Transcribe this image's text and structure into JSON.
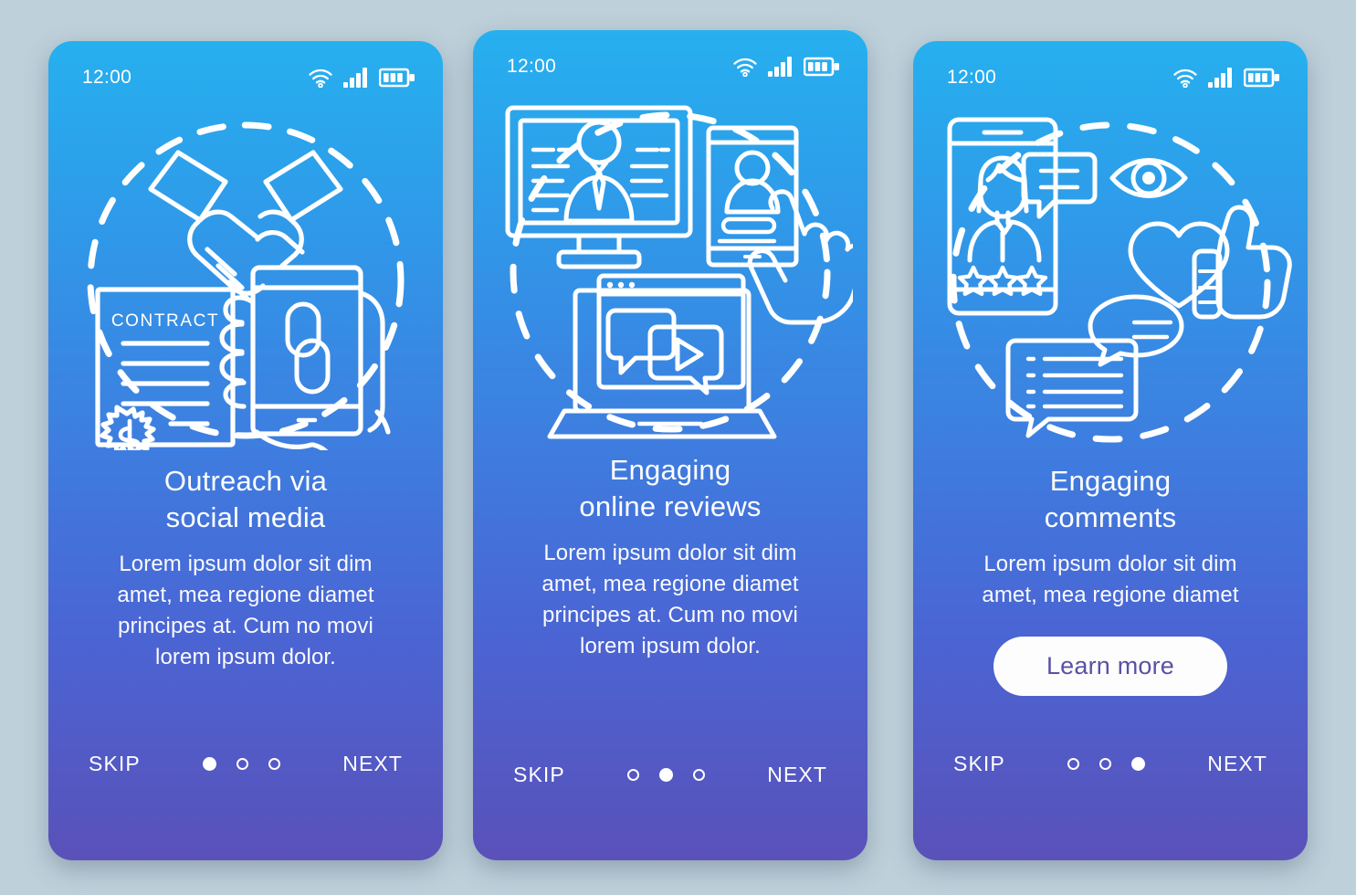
{
  "background_color": "#bed0da",
  "gradient": {
    "top": "#26b0ef",
    "bottom": "#5a51b9"
  },
  "accent": {
    "button_bg": "#fdfdfd",
    "button_text": "#5851a6",
    "line_color": "#ffffff"
  },
  "statusbar": {
    "time": "12:00",
    "icons": [
      "wifi-icon",
      "cellular-signal-icon",
      "battery-icon"
    ]
  },
  "nav_labels": {
    "skip": "SKIP",
    "next": "NEXT"
  },
  "screens": [
    {
      "id": "outreach-via-social-media",
      "title": "Outreach via\nsocial media",
      "body": "Lorem ipsum dolor sit dim\namet, mea regione diamet\nprincipes at. Cum no movi\nlorem ipsum dolor.",
      "illustration": "handshake-contract-phone-link",
      "illustration_elements": [
        "handshake-icon",
        "contract-document-icon",
        "dollar-seal-icon",
        "hand-holding-phone-icon",
        "chain-link-icon",
        "dashed-circle"
      ],
      "contract_label": "CONTRACT",
      "active_dot": 0,
      "dots": 3,
      "cta": null
    },
    {
      "id": "engaging-online-reviews",
      "title": "Engaging\nonline reviews",
      "body": "Lorem ipsum dolor sit dim\namet, mea regione diamet\nprincipes at. Cum no movi\nlorem ipsum dolor.",
      "illustration": "monitor-phone-laptop-reviews",
      "illustration_elements": [
        "desktop-monitor-icon",
        "user-profile-icon",
        "smartphone-icon",
        "pointing-hand-icon",
        "laptop-icon",
        "speech-bubble-icon",
        "play-button-icon",
        "dashed-circle"
      ],
      "active_dot": 1,
      "dots": 3,
      "cta": null
    },
    {
      "id": "engaging-comments",
      "title": "Engaging\ncomments",
      "body": "Lorem ipsum dolor sit dim\namet, mea regione diamet",
      "illustration": "phone-rating-eye-heart-thumb-comments",
      "illustration_elements": [
        "smartphone-icon",
        "woman-avatar-icon",
        "speech-bubble-icon",
        "star-rating-icon",
        "eye-icon",
        "heart-icon",
        "thumbs-up-icon",
        "chat-bubbles-icon",
        "dashed-circle"
      ],
      "star_count": 3,
      "active_dot": 2,
      "dots": 3,
      "cta": "Learn more"
    }
  ]
}
